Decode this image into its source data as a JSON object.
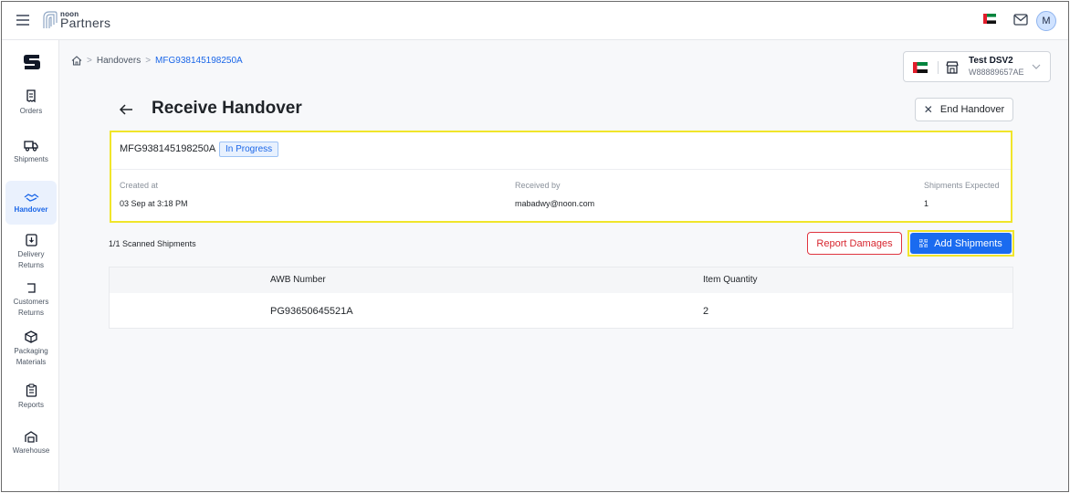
{
  "topbar": {
    "logo_small": "noon",
    "logo_big": "Partners",
    "avatar_initial": "M"
  },
  "sidebar": {
    "items": [
      {
        "label": "Orders",
        "icon": "orders-icon"
      },
      {
        "label": "Shipments",
        "icon": "truck-icon"
      },
      {
        "label": "Handover",
        "icon": "handover-icon",
        "active": true
      },
      {
        "label": "Delivery Returns",
        "icon": "delivery-returns-icon"
      },
      {
        "label": "Customers Returns",
        "icon": "customer-returns-icon"
      },
      {
        "label": "Packaging Materials",
        "icon": "box-icon"
      },
      {
        "label": "Reports",
        "icon": "clipboard-icon"
      },
      {
        "label": "Warehouse",
        "icon": "warehouse-icon"
      }
    ]
  },
  "breadcrumb": {
    "items": [
      "Handovers",
      "MFG938145198250A"
    ]
  },
  "store": {
    "name": "Test DSV2",
    "id": "W88889657AE"
  },
  "page": {
    "title": "Receive Handover",
    "end_label": "End Handover"
  },
  "handover": {
    "id": "MFG938145198250A",
    "status": "In Progress",
    "created_label": "Created at",
    "created_value": "03 Sep at 3:18 PM",
    "received_label": "Received by",
    "received_value": "mabadwy@noon.com",
    "expected_label": "Shipments Expected",
    "expected_value": "1"
  },
  "scan": {
    "summary": "1/1 Scanned Shipments",
    "report_label": "Report Damages",
    "add_label": "Add Shipments"
  },
  "table": {
    "headers": [
      "AWB Number",
      "Item Quantity"
    ],
    "rows": [
      [
        "PG93650645521A",
        "2"
      ]
    ]
  },
  "colors": {
    "accent": "#1a6bf0",
    "highlight": "#f0e52a",
    "danger": "#e0343f"
  }
}
